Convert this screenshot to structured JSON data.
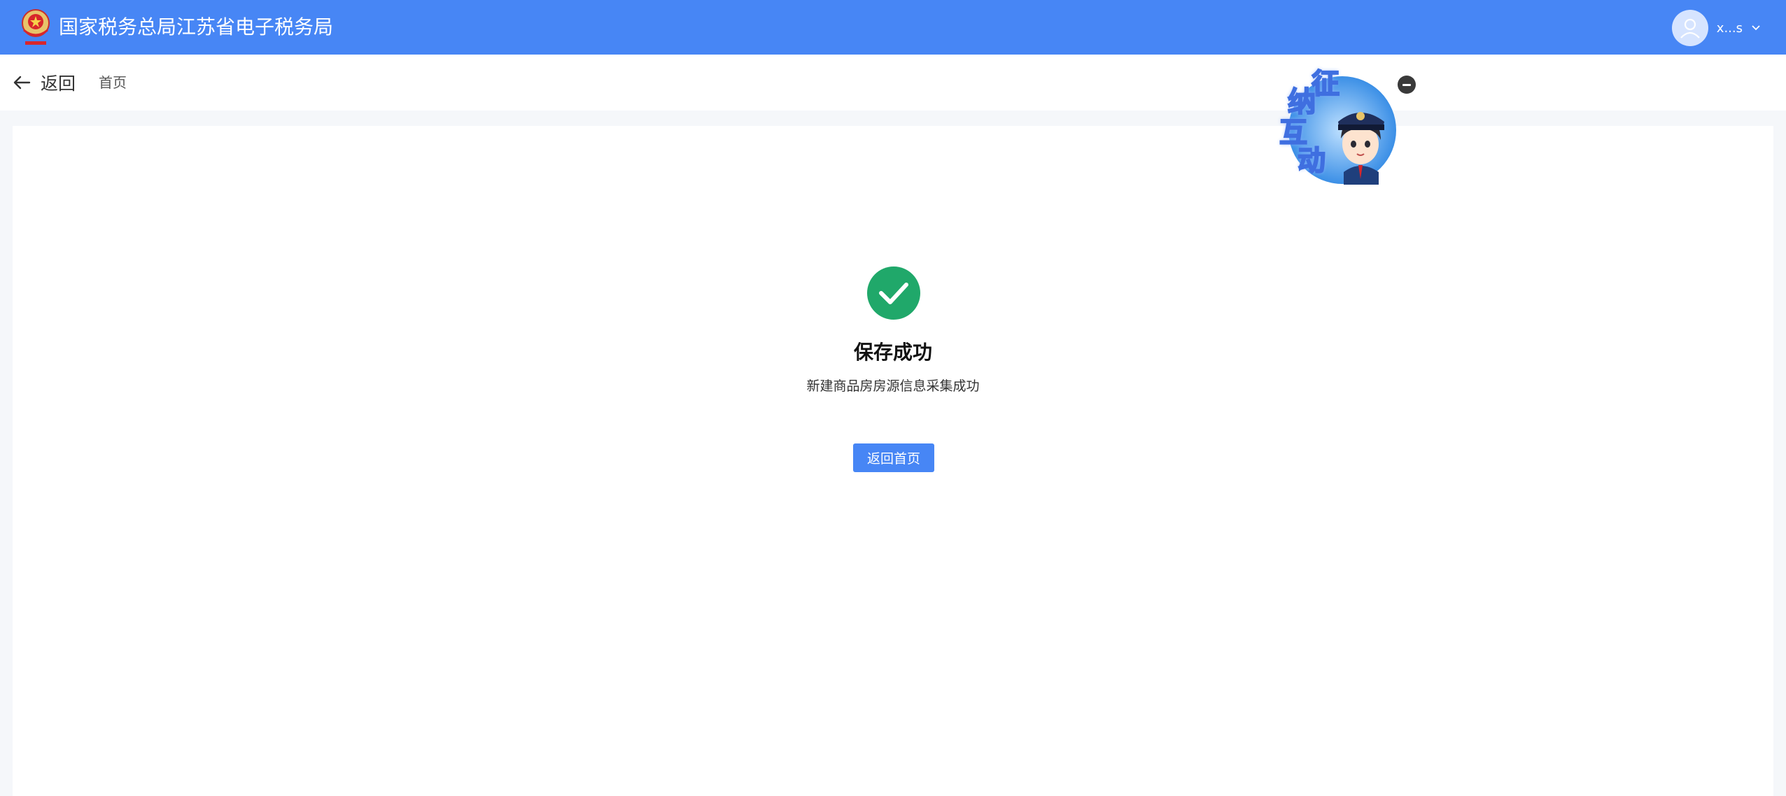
{
  "header": {
    "site_title": "国家税务总局江苏省电子税务局",
    "username": "x...s",
    "brand_color": "#4786f5"
  },
  "subnav": {
    "back_label": "返回",
    "breadcrumb": "首页"
  },
  "result": {
    "status": "success",
    "status_color": "#20a86a",
    "title": "保存成功",
    "description": "新建商品房房源信息采集成功",
    "button_label": "返回首页"
  },
  "assistant": {
    "chars": [
      "征",
      "纳",
      "互",
      "动"
    ]
  },
  "icons": {
    "emblem": "tax-emblem-icon",
    "avatar": "user-avatar-icon",
    "dropdown": "chevron-down-icon",
    "back": "arrow-left-icon",
    "success": "check-circle-icon",
    "close": "minus-circle-icon"
  }
}
